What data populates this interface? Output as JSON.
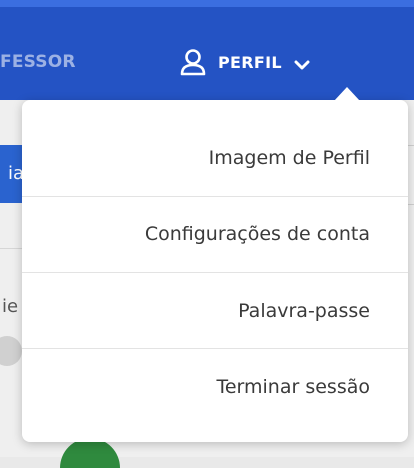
{
  "header": {
    "nav_partial_label": "FESSOR",
    "profile_label": "PERFIL",
    "profile_icon": "user-icon",
    "chevron_icon": "chevron-down-icon"
  },
  "background": {
    "tab_partial": "ia",
    "text_partial": "ie"
  },
  "menu": {
    "items": [
      {
        "label": "Imagem de Perfil"
      },
      {
        "label": "Configurações de conta"
      },
      {
        "label": "Palavra-passe"
      },
      {
        "label": "Terminar sessão"
      }
    ]
  },
  "colors": {
    "header_blue": "#2453c4",
    "menu_text": "#3a3a3a",
    "menu_background": "#ffffff"
  }
}
